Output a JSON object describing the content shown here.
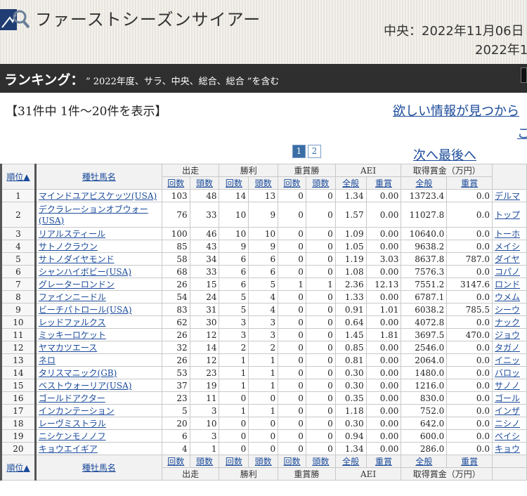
{
  "header": {
    "site_title": "ファーストシーズンサイアー",
    "date_line1": "中央：2022年11月06日",
    "date_line2": "2022年1"
  },
  "ranking": {
    "label": "ランキング：",
    "condition": "” 2022年度、サラ、中央、総合、総合 ”を含む"
  },
  "result_count": "【31件中 1件～20件を表示】",
  "links": {
    "help": "欲しい情報が見つから",
    "help2": "こ",
    "next_last": "次へ最後へ"
  },
  "pager": {
    "pages": [
      "1",
      "2"
    ],
    "current": "1"
  },
  "table": {
    "groups": [
      "出走",
      "勝利",
      "重賞勝",
      "AEI",
      "取得賞金（万円）"
    ],
    "rank_header": "順位▲",
    "name_header": "種牡馬名",
    "sub_headers": [
      "回数",
      "頭数",
      "回数",
      "頭数",
      "回数",
      "頭数",
      "全般",
      "重賞",
      "全般",
      "重賞"
    ],
    "rows": [
      {
        "rank": "1",
        "name": "マインドユアビスケッツ(USA)",
        "c": [
          "103",
          "48",
          "14",
          "13",
          "0",
          "0",
          "1.34",
          "0.00",
          "13723.4",
          "0.0"
        ],
        "sire": "デルマ"
      },
      {
        "rank": "2",
        "name": "デクラレーションオブウォー(USA)",
        "c": [
          "76",
          "33",
          "10",
          "9",
          "0",
          "0",
          "1.57",
          "0.00",
          "11027.8",
          "0.0"
        ],
        "sire": "トップ"
      },
      {
        "rank": "3",
        "name": "リアルスティール",
        "c": [
          "100",
          "46",
          "10",
          "10",
          "0",
          "0",
          "1.09",
          "0.00",
          "10640.0",
          "0.0"
        ],
        "sire": "トーホ"
      },
      {
        "rank": "4",
        "name": "サトノクラウン",
        "c": [
          "85",
          "43",
          "9",
          "9",
          "0",
          "0",
          "1.05",
          "0.00",
          "9638.2",
          "0.0"
        ],
        "sire": "メイシ"
      },
      {
        "rank": "5",
        "name": "サトノダイヤモンド",
        "c": [
          "58",
          "34",
          "6",
          "6",
          "0",
          "0",
          "1.19",
          "3.03",
          "8637.8",
          "787.0"
        ],
        "sire": "ダイヤ"
      },
      {
        "rank": "6",
        "name": "シャンハイボビー(USA)",
        "c": [
          "68",
          "33",
          "6",
          "6",
          "0",
          "0",
          "1.08",
          "0.00",
          "7576.3",
          "0.0"
        ],
        "sire": "コパノ"
      },
      {
        "rank": "7",
        "name": "グレーターロンドン",
        "c": [
          "26",
          "15",
          "6",
          "5",
          "1",
          "1",
          "2.36",
          "12.13",
          "7551.2",
          "3147.6"
        ],
        "sire": "ロンド"
      },
      {
        "rank": "8",
        "name": "ファインニードル",
        "c": [
          "54",
          "24",
          "5",
          "4",
          "0",
          "0",
          "1.33",
          "0.00",
          "6787.1",
          "0.0"
        ],
        "sire": "ウメム"
      },
      {
        "rank": "9",
        "name": "ビーチパトロール(USA)",
        "c": [
          "83",
          "31",
          "5",
          "4",
          "0",
          "0",
          "0.91",
          "1.01",
          "6038.2",
          "785.5"
        ],
        "sire": "シーウ"
      },
      {
        "rank": "10",
        "name": "レッドファルクス",
        "c": [
          "62",
          "30",
          "3",
          "3",
          "0",
          "0",
          "0.64",
          "0.00",
          "4072.8",
          "0.0"
        ],
        "sire": "ナック"
      },
      {
        "rank": "11",
        "name": "ミッキーロケット",
        "c": [
          "26",
          "12",
          "3",
          "3",
          "0",
          "0",
          "1.45",
          "1.81",
          "3697.5",
          "470.0"
        ],
        "sire": "ジョウ"
      },
      {
        "rank": "12",
        "name": "ヤマカツエース",
        "c": [
          "32",
          "14",
          "2",
          "2",
          "0",
          "0",
          "0.85",
          "0.00",
          "2546.0",
          "0.0"
        ],
        "sire": "タガノ"
      },
      {
        "rank": "13",
        "name": "ネロ",
        "c": [
          "26",
          "12",
          "1",
          "1",
          "0",
          "0",
          "0.81",
          "0.00",
          "2064.0",
          "0.0"
        ],
        "sire": "イニッ"
      },
      {
        "rank": "14",
        "name": "タリスマニック(GB)",
        "c": [
          "53",
          "23",
          "1",
          "1",
          "0",
          "0",
          "0.30",
          "0.00",
          "1480.0",
          "0.0"
        ],
        "sire": "バロッ"
      },
      {
        "rank": "15",
        "name": "ベストウォーリア(USA)",
        "c": [
          "37",
          "19",
          "1",
          "1",
          "0",
          "0",
          "0.30",
          "0.00",
          "1216.0",
          "0.0"
        ],
        "sire": "サノノ"
      },
      {
        "rank": "16",
        "name": "ゴールドアクター",
        "c": [
          "23",
          "11",
          "0",
          "0",
          "0",
          "0",
          "0.35",
          "0.00",
          "830.0",
          "0.0"
        ],
        "sire": "ゴール"
      },
      {
        "rank": "17",
        "name": "インカンテーション",
        "c": [
          "5",
          "3",
          "1",
          "1",
          "0",
          "0",
          "1.18",
          "0.00",
          "752.0",
          "0.0"
        ],
        "sire": "インザ"
      },
      {
        "rank": "18",
        "name": "レーヴミストラル",
        "c": [
          "20",
          "10",
          "0",
          "0",
          "0",
          "0",
          "0.30",
          "0.00",
          "642.0",
          "0.0"
        ],
        "sire": "ニシノ"
      },
      {
        "rank": "19",
        "name": "ニシケンモノノフ",
        "c": [
          "6",
          "3",
          "0",
          "0",
          "0",
          "0",
          "0.94",
          "0.00",
          "600.0",
          "0.0"
        ],
        "sire": "ペイシ"
      },
      {
        "rank": "20",
        "name": "キョウエイギア",
        "c": [
          "4",
          "1",
          "0",
          "0",
          "0",
          "0",
          "1.34",
          "0.00",
          "286.0",
          "0.0"
        ],
        "sire": "キョウ"
      }
    ]
  }
}
